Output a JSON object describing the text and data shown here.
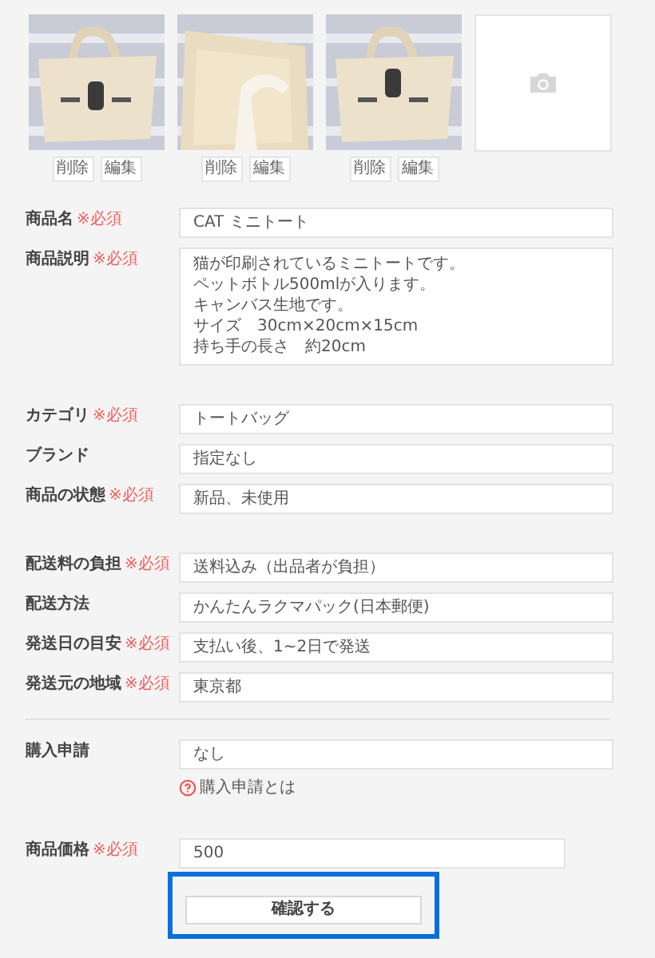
{
  "photos": [
    {
      "kind": "picture",
      "buttons": [
        "削除",
        "編集"
      ]
    },
    {
      "kind": "picture",
      "buttons": [
        "削除",
        "編集"
      ]
    },
    {
      "kind": "picture",
      "buttons": [
        "削除",
        "編集"
      ]
    },
    {
      "kind": "empty"
    }
  ],
  "sections": [
    {
      "kind": "group",
      "rows": [
        {
          "kind": "input",
          "label": "商品名",
          "required_text": "※必須",
          "value": "CAT ミニトート"
        },
        {
          "kind": "textarea",
          "label": "商品説明",
          "required_text": "※必須",
          "lines": [
            "猫が印刷されているミニトートです。",
            "ペットボトル500mlが入ります。",
            "キャンバス生地です。",
            "サイズ　30cm×20cm×15cm",
            "持ち手の長さ　約20cm"
          ]
        }
      ]
    },
    {
      "kind": "group",
      "rows": [
        {
          "kind": "input",
          "label": "カテゴリ",
          "required_text": "※必須",
          "value": "トートバッグ"
        },
        {
          "kind": "input",
          "label": "ブランド",
          "value": "指定なし"
        },
        {
          "kind": "input",
          "label": "商品の状態",
          "required_text": "※必須",
          "value": "新品、未使用"
        }
      ]
    },
    {
      "kind": "group",
      "rows": [
        {
          "kind": "input",
          "label": "配送料の負担",
          "required_text": "※必須",
          "value": "送料込み（出品者が負担）"
        },
        {
          "kind": "input",
          "label": "配送方法",
          "value": "かんたんラクマパック(日本郵便)"
        },
        {
          "kind": "input",
          "label": "発送日の目安",
          "required_text": "※必須",
          "value": "支払い後、1~2日で発送"
        },
        {
          "kind": "input",
          "label": "発送元の地域",
          "required_text": "※必須",
          "value": "東京都"
        }
      ]
    },
    {
      "kind": "rule"
    },
    {
      "kind": "group",
      "rows": [
        {
          "kind": "input",
          "label": "購入申請",
          "value": "なし",
          "help": "購入申請とは"
        }
      ]
    },
    {
      "kind": "group",
      "rows": [
        {
          "kind": "short-input",
          "label": "商品価格",
          "required_text": "※必須",
          "value": "500"
        }
      ]
    }
  ],
  "submit": {
    "label": "確認する",
    "highlighted": true
  }
}
